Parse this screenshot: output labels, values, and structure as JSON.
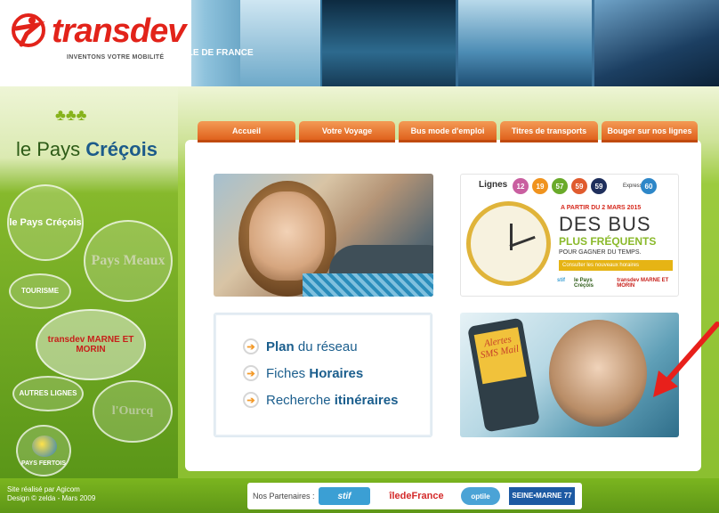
{
  "header": {
    "brand": "transdev",
    "slogan": "INVENTONS VOTRE MOBILITÉ",
    "region": "ILE DE FRANCE"
  },
  "sidebar": {
    "title_part1": "le Pays ",
    "title_part2": "Créçois",
    "items": [
      {
        "label": "le Pays Créçois"
      },
      {
        "label": "Pays Meaux"
      },
      {
        "label": "TOURISME"
      },
      {
        "label": "transdev MARNE ET MORIN"
      },
      {
        "label": "AUTRES LIGNES"
      },
      {
        "label": "l'Ourcq"
      },
      {
        "label": "PAYS FERTOIS"
      }
    ]
  },
  "tabs": [
    {
      "label": "Accueil"
    },
    {
      "label": "Votre Voyage"
    },
    {
      "label": "Bus mode d'emploi"
    },
    {
      "label": "Titres de transports"
    },
    {
      "label": "Bouger sur nos lignes"
    }
  ],
  "lines_tile": {
    "label": "Lignes",
    "lines": [
      {
        "num": "12",
        "color": "#c95fa0"
      },
      {
        "num": "19",
        "color": "#f0931e"
      },
      {
        "num": "57",
        "color": "#6aaa2a"
      },
      {
        "num": "59",
        "color": "#e05b2e"
      },
      {
        "num": "59",
        "color": "#1f2f5c"
      },
      {
        "num": "60",
        "color": "#2e87c8"
      }
    ],
    "express": "Express",
    "date_text": "A PARTIR DU 2 MARS 2015",
    "headline": "DES BUS",
    "subheadline": "PLUS FRÉQUENTS",
    "pour": "POUR GAGNER DU TEMPS.",
    "consult": "Consulter les nouveaux horaires",
    "mini_logos": [
      "stif",
      "le Pays Créçois",
      "transdev MARNE ET MORIN"
    ]
  },
  "links_tile": {
    "links": [
      {
        "bold": "Plan",
        "rest": " du réseau"
      },
      {
        "pre": "Fiches ",
        "bold": "Horaires"
      },
      {
        "pre": "Recherche ",
        "bold": "itinéraires"
      }
    ]
  },
  "sms_tile": {
    "screen_text": "Alertes SMS Mail"
  },
  "footer": {
    "credit_line1": "Site réalisé par Agicom",
    "credit_line2": "Design © zelda - Mars 2009",
    "partners_label": "Nos Partenaires :",
    "partners": [
      "stif",
      "îledeFrance",
      "optile",
      "SEINE•MARNE 77"
    ]
  },
  "colors": {
    "brand_red": "#e2231a",
    "tab_orange": "#e0621d",
    "green": "#8bbf30",
    "link_blue": "#1b5e8d"
  }
}
